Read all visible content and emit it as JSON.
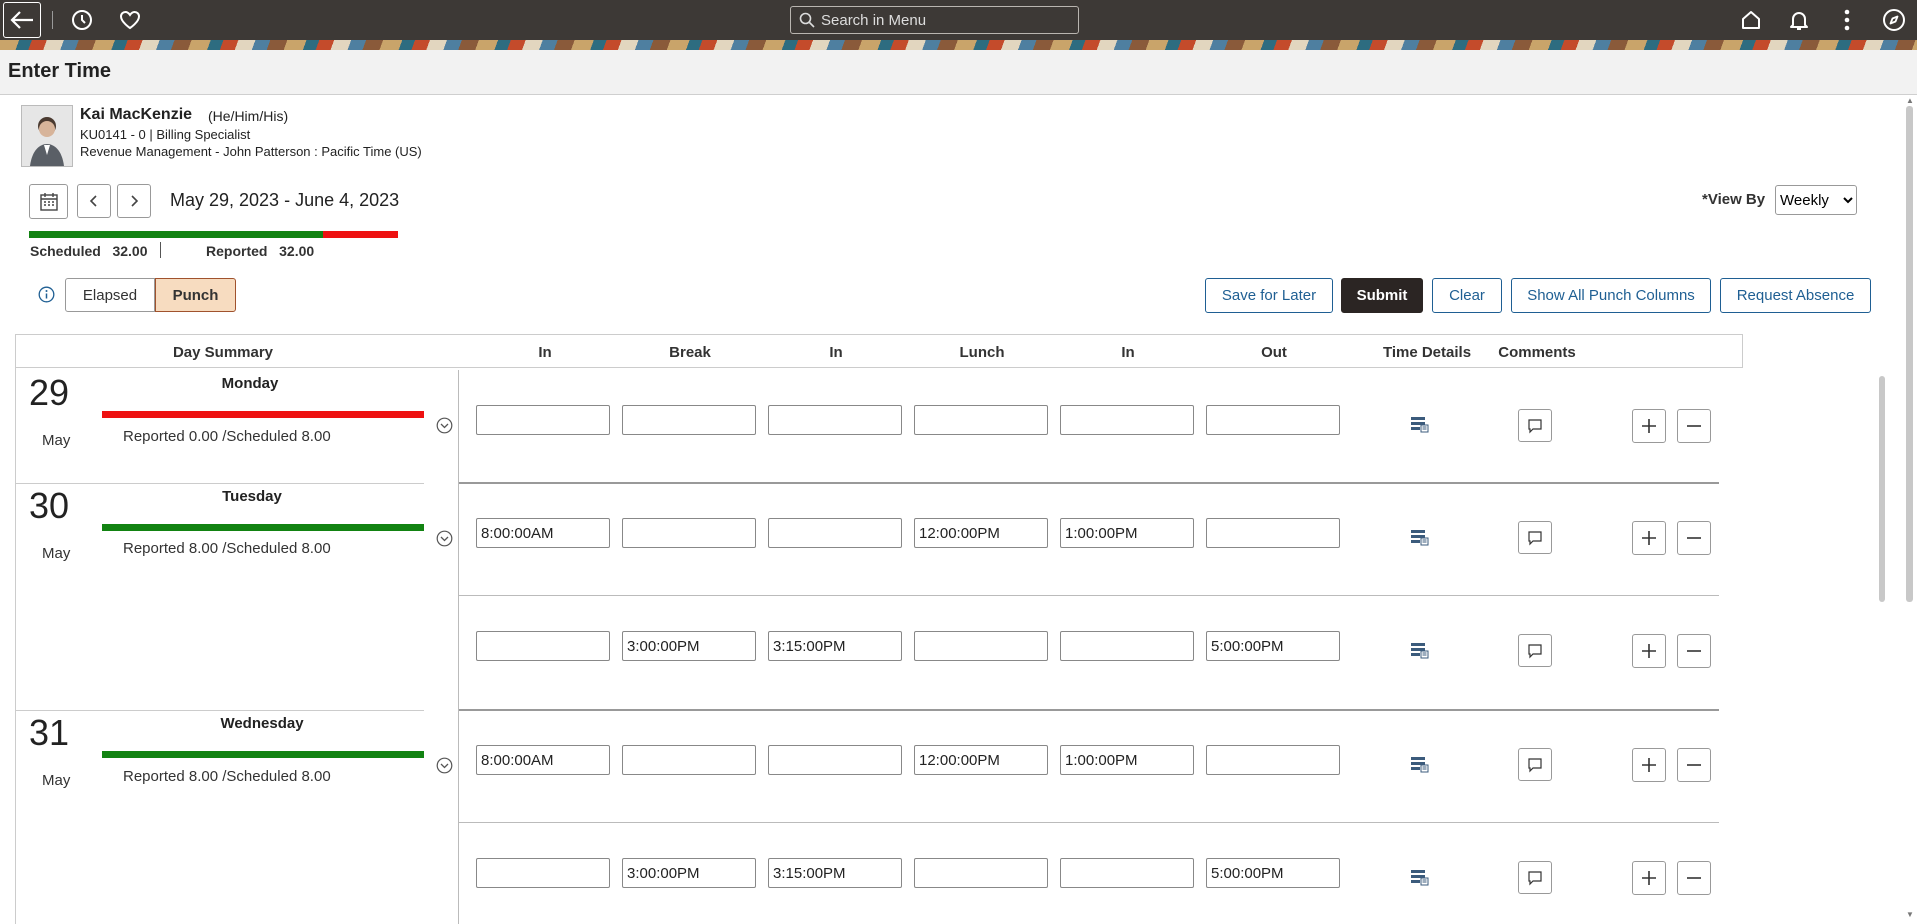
{
  "topbar": {
    "search_placeholder": "Search in Menu",
    "icons": [
      "back-arrow-icon",
      "history-icon",
      "heart-icon",
      "home-icon",
      "bell-icon",
      "more-vertical-icon",
      "compass-icon"
    ]
  },
  "page": {
    "title": "Enter Time"
  },
  "employee": {
    "name": "Kai MacKenzie",
    "pronouns": "(He/Him/His)",
    "line2": "KU0141 - 0 | Billing Specialist",
    "line3": "Revenue Management - John Patterson : Pacific Time (US)"
  },
  "period": {
    "date_range": "May 29, 2023 - June 4, 2023"
  },
  "view_by": {
    "label": "*View By",
    "selected": "Weekly"
  },
  "summary": {
    "scheduled_label": "Scheduled",
    "scheduled_value": "32.00",
    "reported_label": "Reported",
    "reported_value": "32.00",
    "reported_fraction": 0.8
  },
  "mode": {
    "elapsed": "Elapsed",
    "punch": "Punch",
    "active": "Punch"
  },
  "actions": {
    "save_later": "Save for Later",
    "submit": "Submit",
    "clear": "Clear",
    "show_all": "Show All Punch Columns",
    "request_absence": "Request Absence"
  },
  "columns": [
    "Day Summary",
    "In",
    "Break",
    "In",
    "Lunch",
    "In",
    "Out",
    "Time Details",
    "Comments"
  ],
  "days": [
    {
      "num": "29",
      "month": "May",
      "name": "Monday",
      "status": "Reported 0.00 /Scheduled 8.00",
      "bar_color": "#ee1111",
      "rows": [
        [
          "",
          "",
          "",
          "",
          "",
          ""
        ]
      ]
    },
    {
      "num": "30",
      "month": "May",
      "name": "Tuesday",
      "status": "Reported 8.00 /Scheduled 8.00",
      "bar_color": "#128312",
      "rows": [
        [
          "8:00:00AM",
          "",
          "",
          "12:00:00PM",
          "1:00:00PM",
          ""
        ],
        [
          "",
          "3:00:00PM",
          "3:15:00PM",
          "",
          "",
          "5:00:00PM"
        ]
      ]
    },
    {
      "num": "31",
      "month": "May",
      "name": "Wednesday",
      "status": "Reported 8.00 /Scheduled 8.00",
      "bar_color": "#128312",
      "rows": [
        [
          "8:00:00AM",
          "",
          "",
          "12:00:00PM",
          "1:00:00PM",
          ""
        ],
        [
          "",
          "3:00:00PM",
          "3:15:00PM",
          "",
          "",
          "5:00:00PM"
        ]
      ]
    }
  ]
}
